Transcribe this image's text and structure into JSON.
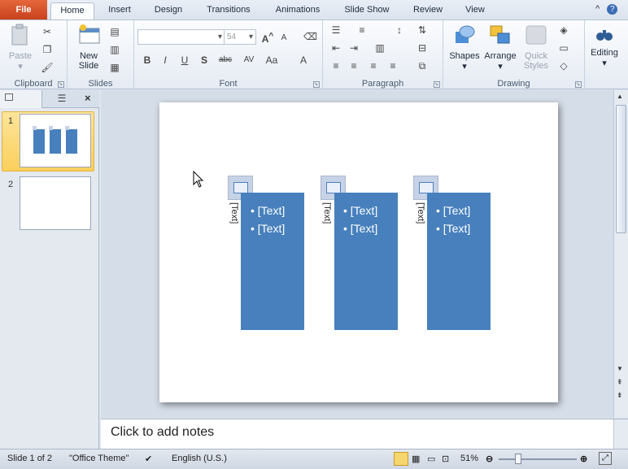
{
  "tabs": [
    "File",
    "Home",
    "Insert",
    "Design",
    "Transitions",
    "Animations",
    "Slide Show",
    "Review",
    "View"
  ],
  "ribbon": {
    "clipboard": {
      "label": "Clipboard",
      "paste": "Paste"
    },
    "slides": {
      "label": "Slides",
      "new_slide": "New Slide"
    },
    "font": {
      "label": "Font",
      "font_size": "54",
      "bold": "B",
      "italic": "I",
      "underline": "U",
      "shadow": "S",
      "strike": "abc",
      "spacing": "AV",
      "case": "Aa",
      "color": "A"
    },
    "paragraph": {
      "label": "Paragraph"
    },
    "drawing": {
      "label": "Drawing",
      "shapes": "Shapes",
      "arrange": "Arrange",
      "quick_styles": "Quick Styles"
    },
    "editing": {
      "label": "Editing"
    }
  },
  "slide_panel": {
    "slides": [
      {
        "num": "1"
      },
      {
        "num": "2"
      }
    ]
  },
  "slide": {
    "columns": [
      {
        "label": "[Text]",
        "bullets": [
          "[Text]",
          "[Text]"
        ]
      },
      {
        "label": "[Text]",
        "bullets": [
          "[Text]",
          "[Text]"
        ]
      },
      {
        "label": "[Text]",
        "bullets": [
          "[Text]",
          "[Text]"
        ]
      }
    ]
  },
  "notes": {
    "placeholder": "Click to add notes"
  },
  "status": {
    "slide_info": "Slide 1 of 2",
    "theme": "\"Office Theme\"",
    "language": "English (U.S.)",
    "zoom": "51%"
  },
  "colors": {
    "accent": "#4780bc",
    "file_tab": "#d4542a"
  }
}
